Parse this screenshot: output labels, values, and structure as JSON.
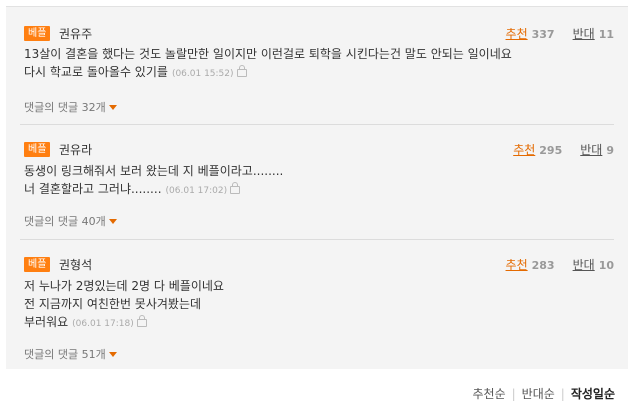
{
  "comments": [
    {
      "badge": "베플",
      "author": "권유주",
      "recommend_label": "추천",
      "recommend_count": "337",
      "oppose_label": "반대",
      "oppose_count": "11",
      "lines": [
        "13살이 결혼을 했다는 것도 놀랄만한 일이지만 이런걸로 퇴학을 시킨다는건 말도 안되는 일이네요",
        "다시 학교로 돌아올수 있기를"
      ],
      "timestamp": "(06.01 15:52)",
      "replies": "댓글의 댓글 32개"
    },
    {
      "badge": "베플",
      "author": "권유라",
      "recommend_label": "추천",
      "recommend_count": "295",
      "oppose_label": "반대",
      "oppose_count": "9",
      "lines": [
        "동생이 링크해줘서 보러 왔는데 지 베플이라고........",
        "너 결혼할라고 그러냐........"
      ],
      "timestamp": "(06.01 17:02)",
      "replies": "댓글의 댓글 40개"
    },
    {
      "badge": "베플",
      "author": "권형석",
      "recommend_label": "추천",
      "recommend_count": "283",
      "oppose_label": "반대",
      "oppose_count": "10",
      "lines": [
        "저 누나가 2명있는데 2명 다 베플이네요",
        "전 지금까지 여친한번 못사겨봤는데",
        "부러워요"
      ],
      "timestamp": "(06.01 17:18)",
      "replies": "댓글의 댓글 51개"
    }
  ],
  "sort": {
    "recommend": "추천순",
    "oppose": "반대순",
    "date": "작성일순"
  }
}
